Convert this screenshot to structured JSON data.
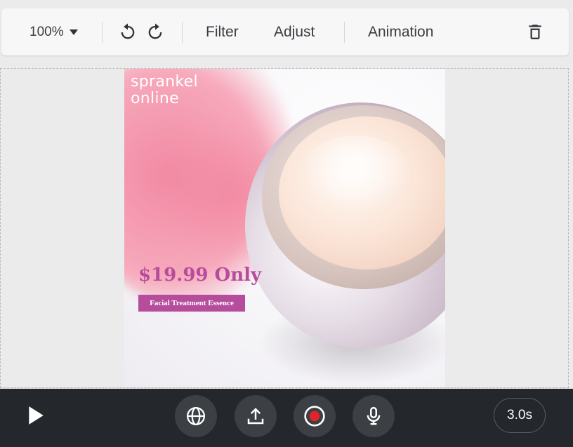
{
  "toolbar": {
    "zoom": "100%",
    "undo_icon": "undo-icon",
    "redo_icon": "redo-icon",
    "filter_label": "Filter",
    "adjust_label": "Adjust",
    "animation_label": "Animation",
    "delete_icon": "trash-icon"
  },
  "poster": {
    "brand_line1": "sprankel",
    "brand_line2": "online",
    "price": "$19.99 Only",
    "tag": "Facial Treatment Essence",
    "accent_color": "#b64d9c"
  },
  "bottombar": {
    "play_icon": "play-icon",
    "buttons": [
      "globe-icon",
      "upload-icon",
      "record-icon",
      "microphone-icon"
    ],
    "record_color": "#e0242b",
    "duration": "3.0s"
  }
}
